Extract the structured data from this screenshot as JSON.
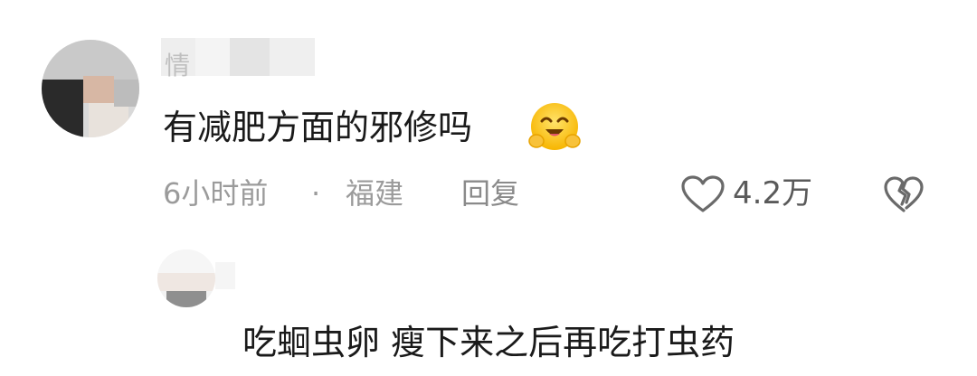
{
  "comment": {
    "username": "情",
    "text": "有减肥方面的邪修吗",
    "emoji": "smiling-face-hugging-emoji",
    "time": "6小时前",
    "separator": "·",
    "location": "福建",
    "reply_label": "回复",
    "like_icon": "heart-outline-icon",
    "like_count": "4.2万",
    "dislike_icon": "broken-heart-outline-icon"
  },
  "reply": {
    "text": "吃蛔虫卵 瘦下来之后再吃打虫药"
  }
}
